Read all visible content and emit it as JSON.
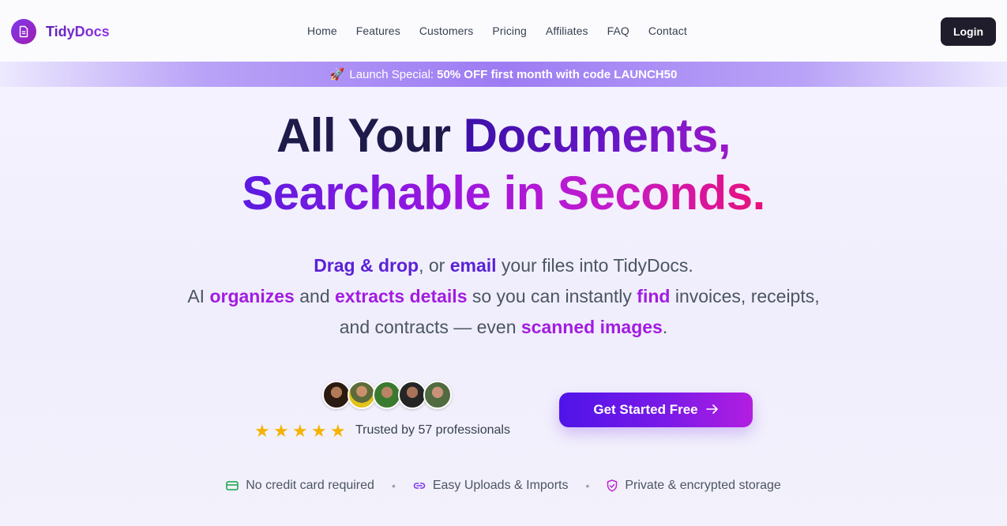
{
  "brand": {
    "name": "TidyDocs",
    "logo_icon": "document-icon",
    "accent": "#7c3aed"
  },
  "nav": {
    "items": [
      "Home",
      "Features",
      "Customers",
      "Pricing",
      "Affiliates",
      "FAQ",
      "Contact"
    ]
  },
  "header": {
    "login_label": "Login"
  },
  "banner": {
    "icon": "rocket-icon",
    "prefix": "Launch Special:",
    "highlight": "50% OFF first month with code LAUNCH50"
  },
  "hero": {
    "line1_dark": "All Your ",
    "line1_grad": "Documents,",
    "line2": "Searchable in Seconds."
  },
  "subheading": {
    "l1": {
      "a": "Drag & drop",
      "b": ", or ",
      "c": "email",
      "d": " your files into TidyDocs."
    },
    "l2": {
      "a": "AI ",
      "b": "organizes",
      "c": " and ",
      "d": "extracts details",
      "e": " so you can instantly ",
      "f": "find",
      "g": " invoices, receipts,"
    },
    "l3": {
      "a": "and contracts — even ",
      "b": "scanned images",
      "c": "."
    }
  },
  "social_proof": {
    "avatar_count": 5,
    "rating_stars": 5,
    "trusted_text": "Trusted by 57 professionals",
    "star_color": "#f5b301"
  },
  "cta": {
    "label": "Get Started Free",
    "icon": "arrow-right-icon"
  },
  "features": [
    {
      "icon": "credit-card-icon",
      "label": "No credit card required",
      "color": "#16a34a"
    },
    {
      "icon": "link-icon",
      "label": "Easy Uploads & Imports",
      "color": "#7c3aed"
    },
    {
      "icon": "shield-check-icon",
      "label": "Private & encrypted storage",
      "color": "#c026d3"
    }
  ]
}
